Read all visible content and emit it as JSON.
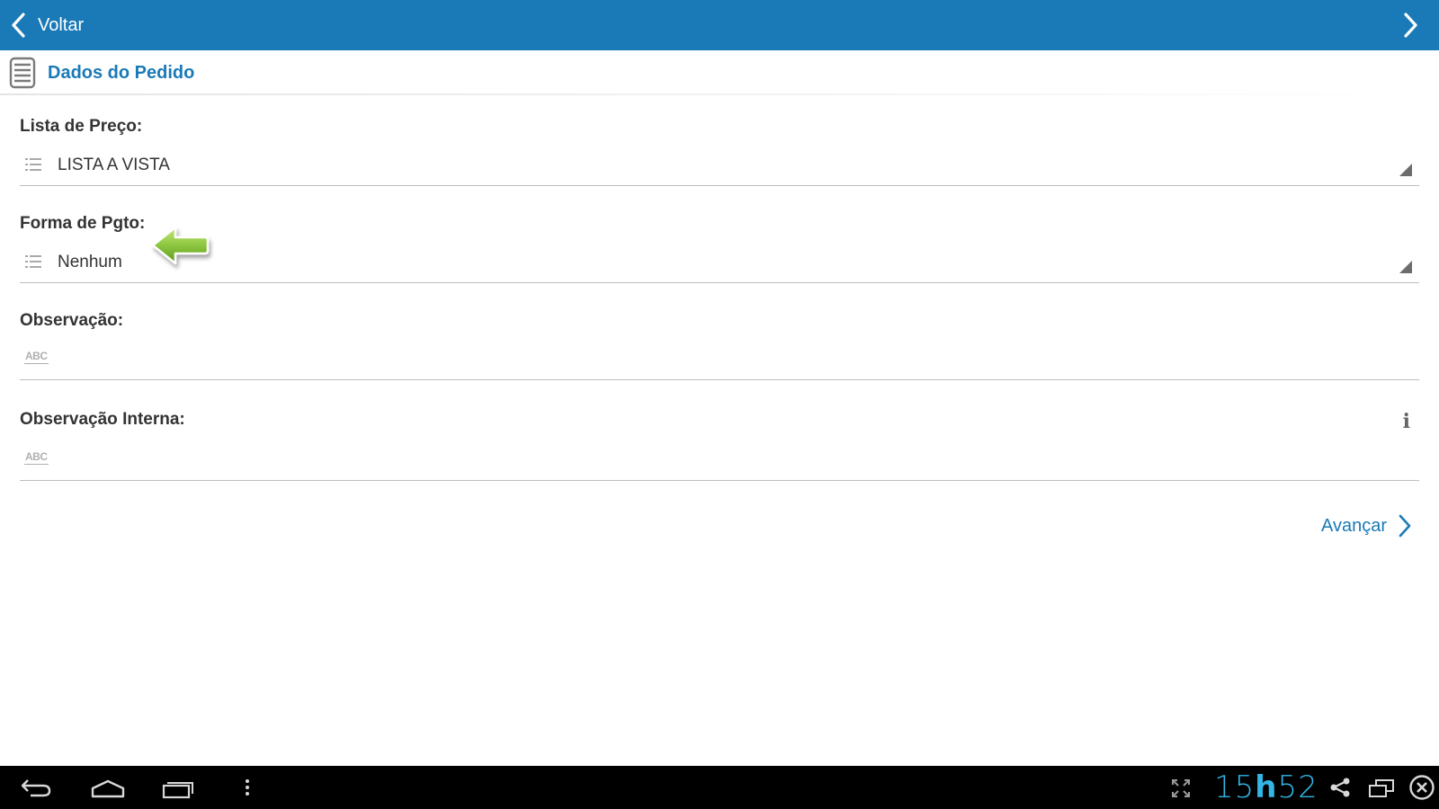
{
  "app_bar": {
    "back_label": "Voltar"
  },
  "section": {
    "title": "Dados do Pedido"
  },
  "fields": [
    {
      "label": "Lista de Preço:",
      "value": "LISTA A VISTA",
      "type": "dropdown"
    },
    {
      "label": "Forma de Pgto:",
      "value": "Nenhum",
      "type": "dropdown"
    },
    {
      "label": "Observação:",
      "value": "",
      "type": "text"
    },
    {
      "label": "Observação Interna:",
      "value": "",
      "type": "text"
    }
  ],
  "abc_icon_text": "ABC",
  "info_icon_glyph": "i",
  "actions": {
    "advance_label": "Avançar"
  },
  "system_bar": {
    "clock_hours": "15",
    "clock_separator": "h",
    "clock_minutes": "52"
  },
  "colors": {
    "app_bar": "#1a7ab7",
    "accent": "#1a7ab7",
    "clock": "#33b5e5",
    "callout_arrow": "#8cc63f"
  },
  "icons": {
    "back": "chevron-left-icon",
    "forward": "chevron-right-icon",
    "section": "document-icon",
    "list": "list-icon",
    "text": "abc-icon",
    "info": "info-icon",
    "callout": "green-arrow-left-icon"
  }
}
